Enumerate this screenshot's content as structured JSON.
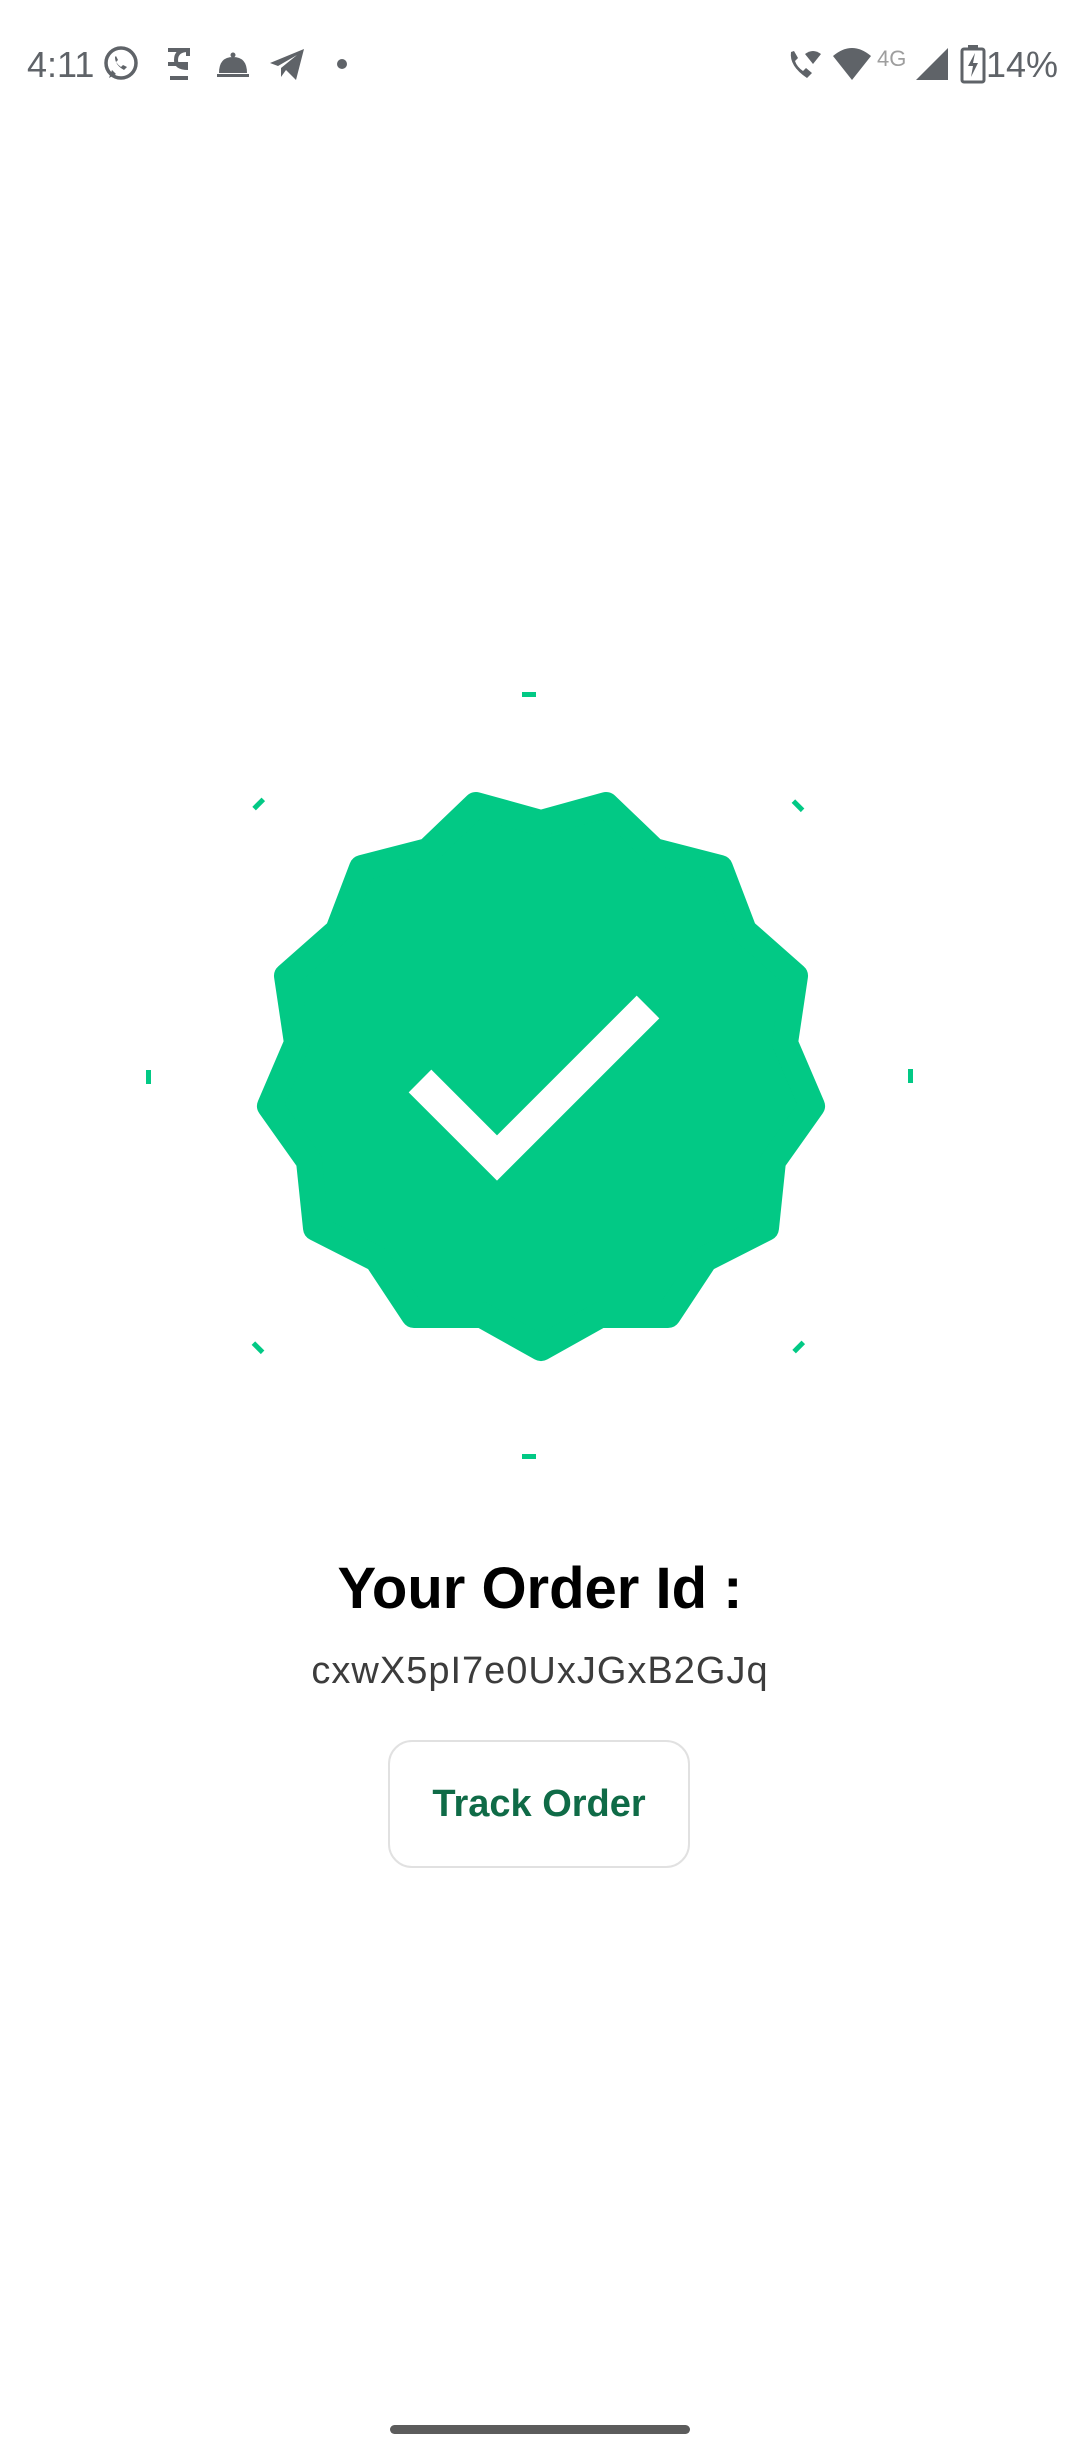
{
  "status_bar": {
    "time": "4:11",
    "network_label": "4G",
    "battery": "14%",
    "left_icons": [
      "whatsapp-icon",
      "sim-icon",
      "food-cloche-icon",
      "telegram-icon",
      "dot-icon"
    ],
    "right_icons": [
      "wifi-calling-icon",
      "wifi-icon",
      "signal-icon",
      "battery-charging-icon"
    ]
  },
  "hero": {
    "badge_icon": "verified-check-badge-icon",
    "accent_color": "#02c985"
  },
  "order": {
    "title": "Your Order Id :",
    "id": "cxwX5pI7e0UxJGxB2GJq"
  },
  "actions": {
    "track_label": "Track Order"
  }
}
